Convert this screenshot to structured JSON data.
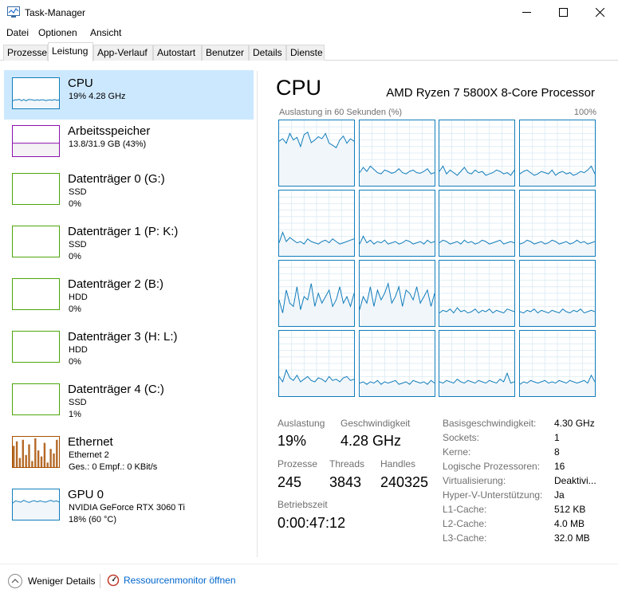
{
  "window": {
    "title": "Task-Manager"
  },
  "menu": [
    "Datei",
    "Optionen",
    "Ansicht"
  ],
  "tabs": [
    "Prozesse",
    "Leistung",
    "App-Verlauf",
    "Autostart",
    "Benutzer",
    "Details",
    "Dienste"
  ],
  "active_tab": "Leistung",
  "sidebar": {
    "items": [
      {
        "title": "CPU",
        "line1": "19% 4.28 GHz",
        "line2": "",
        "color": "#117dbb"
      },
      {
        "title": "Arbeitsspeicher",
        "line1": "13.8/31.9 GB (43%)",
        "line2": "",
        "color": "#8b12ae"
      },
      {
        "title": "Datenträger 0 (G:)",
        "line1": "SSD",
        "line2": "0%",
        "color": "#4da60c"
      },
      {
        "title": "Datenträger 1 (P: K:)",
        "line1": "SSD",
        "line2": "0%",
        "color": "#4da60c"
      },
      {
        "title": "Datenträger 2 (B:)",
        "line1": "HDD",
        "line2": "0%",
        "color": "#4da60c"
      },
      {
        "title": "Datenträger 3 (H: L:)",
        "line1": "HDD",
        "line2": "0%",
        "color": "#4da60c"
      },
      {
        "title": "Datenträger 4 (C:)",
        "line1": "SSD",
        "line2": "1%",
        "color": "#4da60c"
      },
      {
        "title": "Ethernet",
        "line1": "Ethernet 2",
        "line2": "Ges.: 0 Empf.: 0 KBit/s",
        "color": "#a74f01"
      },
      {
        "title": "GPU 0",
        "line1": "NVIDIA GeForce RTX 3060 Ti",
        "line2": "18% (60 °C)",
        "color": "#117dbb"
      }
    ]
  },
  "cpu": {
    "title": "CPU",
    "model": "AMD Ryzen 7 5800X 8-Core Processor",
    "graph_label": "Auslastung in 60 Sekunden (%)",
    "graph_max": "100%",
    "accent": "#117dbb",
    "cores": [
      [
        68,
        72,
        65,
        80,
        70,
        74,
        60,
        78,
        82,
        66,
        70,
        75,
        72,
        80,
        65,
        62,
        58,
        70,
        76,
        65,
        72,
        68
      ],
      [
        20,
        28,
        22,
        30,
        25,
        20,
        18,
        24,
        22,
        19,
        21,
        26,
        20,
        18,
        22,
        24,
        20,
        19,
        22,
        26,
        18,
        20
      ],
      [
        22,
        30,
        18,
        24,
        20,
        16,
        22,
        28,
        20,
        18,
        24,
        20,
        22,
        16,
        18,
        20,
        24,
        22,
        18,
        20,
        16,
        24
      ],
      [
        18,
        22,
        24,
        20,
        16,
        18,
        22,
        20,
        18,
        24,
        16,
        20,
        22,
        18,
        20,
        16,
        18,
        22,
        20,
        24,
        30,
        18
      ],
      [
        20,
        36,
        22,
        28,
        24,
        20,
        22,
        18,
        26,
        22,
        20,
        18,
        22,
        24,
        20,
        26,
        22,
        18,
        20,
        22,
        24,
        26
      ],
      [
        18,
        30,
        20,
        24,
        18,
        22,
        20,
        24,
        18,
        20,
        22,
        18,
        20,
        24,
        22,
        18,
        20,
        22,
        18,
        24,
        20,
        22
      ],
      [
        20,
        24,
        22,
        18,
        20,
        22,
        18,
        24,
        20,
        22,
        18,
        20,
        24,
        22,
        18,
        20,
        22,
        24,
        18,
        20,
        22,
        20
      ],
      [
        18,
        20,
        24,
        22,
        18,
        20,
        22,
        18,
        20,
        24,
        22,
        18,
        20,
        22,
        18,
        20,
        24,
        20,
        22,
        18,
        20,
        22
      ],
      [
        40,
        20,
        55,
        35,
        30,
        60,
        25,
        45,
        40,
        65,
        30,
        50,
        35,
        45,
        55,
        30,
        40,
        60,
        35,
        45,
        30,
        50
      ],
      [
        25,
        45,
        35,
        60,
        30,
        55,
        40,
        50,
        65,
        35,
        45,
        60,
        30,
        55,
        50,
        40,
        60,
        35,
        45,
        55,
        30,
        50
      ],
      [
        20,
        24,
        22,
        26,
        20,
        28,
        22,
        24,
        20,
        22,
        26,
        20,
        24,
        22,
        26,
        20,
        24,
        22,
        20,
        26,
        24,
        22
      ],
      [
        22,
        20,
        24,
        22,
        26,
        20,
        24,
        22,
        20,
        24,
        22,
        20,
        26,
        22,
        20,
        24,
        22,
        26,
        20,
        22,
        24,
        22
      ],
      [
        30,
        22,
        40,
        28,
        24,
        32,
        22,
        26,
        30,
        24,
        22,
        28,
        26,
        22,
        30,
        24,
        26,
        22,
        28,
        30,
        24,
        26
      ],
      [
        20,
        22,
        18,
        22,
        20,
        24,
        18,
        22,
        20,
        22,
        24,
        18,
        20,
        22,
        18,
        24,
        22,
        20,
        22,
        18,
        24,
        20
      ],
      [
        22,
        20,
        24,
        22,
        20,
        26,
        22,
        20,
        24,
        22,
        20,
        24,
        22,
        20,
        24,
        22,
        20,
        26,
        22,
        35,
        20,
        22
      ],
      [
        18,
        22,
        20,
        24,
        22,
        20,
        22,
        24,
        20,
        22,
        20,
        24,
        22,
        20,
        24,
        22,
        20,
        22,
        24,
        20,
        32,
        22
      ]
    ]
  },
  "stats": {
    "utilization_label": "Auslastung",
    "utilization": "19%",
    "speed_label": "Geschwindigkeit",
    "speed": "4.28 GHz",
    "processes_label": "Prozesse",
    "processes": "245",
    "threads_label": "Threads",
    "threads": "3843",
    "handles_label": "Handles",
    "handles": "240325",
    "uptime_label": "Betriebszeit",
    "uptime": "0:00:47:12"
  },
  "info": [
    {
      "label": "Basisgeschwindigkeit:",
      "value": "4.30 GHz"
    },
    {
      "label": "Sockets:",
      "value": "1"
    },
    {
      "label": "Kerne:",
      "value": "8"
    },
    {
      "label": "Logische Prozessoren:",
      "value": "16"
    },
    {
      "label": "Virtualisierung:",
      "value": "Deaktivi..."
    },
    {
      "label": "Hyper-V-Unterstützung:",
      "value": "Ja"
    },
    {
      "label": "L1-Cache:",
      "value": "512 KB"
    },
    {
      "label": "L2-Cache:",
      "value": "4.0 MB"
    },
    {
      "label": "L3-Cache:",
      "value": "32.0 MB"
    }
  ],
  "footer": {
    "fewer_details": "Weniger Details",
    "resource_monitor": "Ressourcenmonitor öffnen"
  },
  "memory_level": 0.43,
  "ethernet_bars": [
    70,
    85,
    30,
    90,
    40,
    75,
    20,
    95,
    55,
    35,
    80,
    15,
    60,
    45,
    90
  ]
}
